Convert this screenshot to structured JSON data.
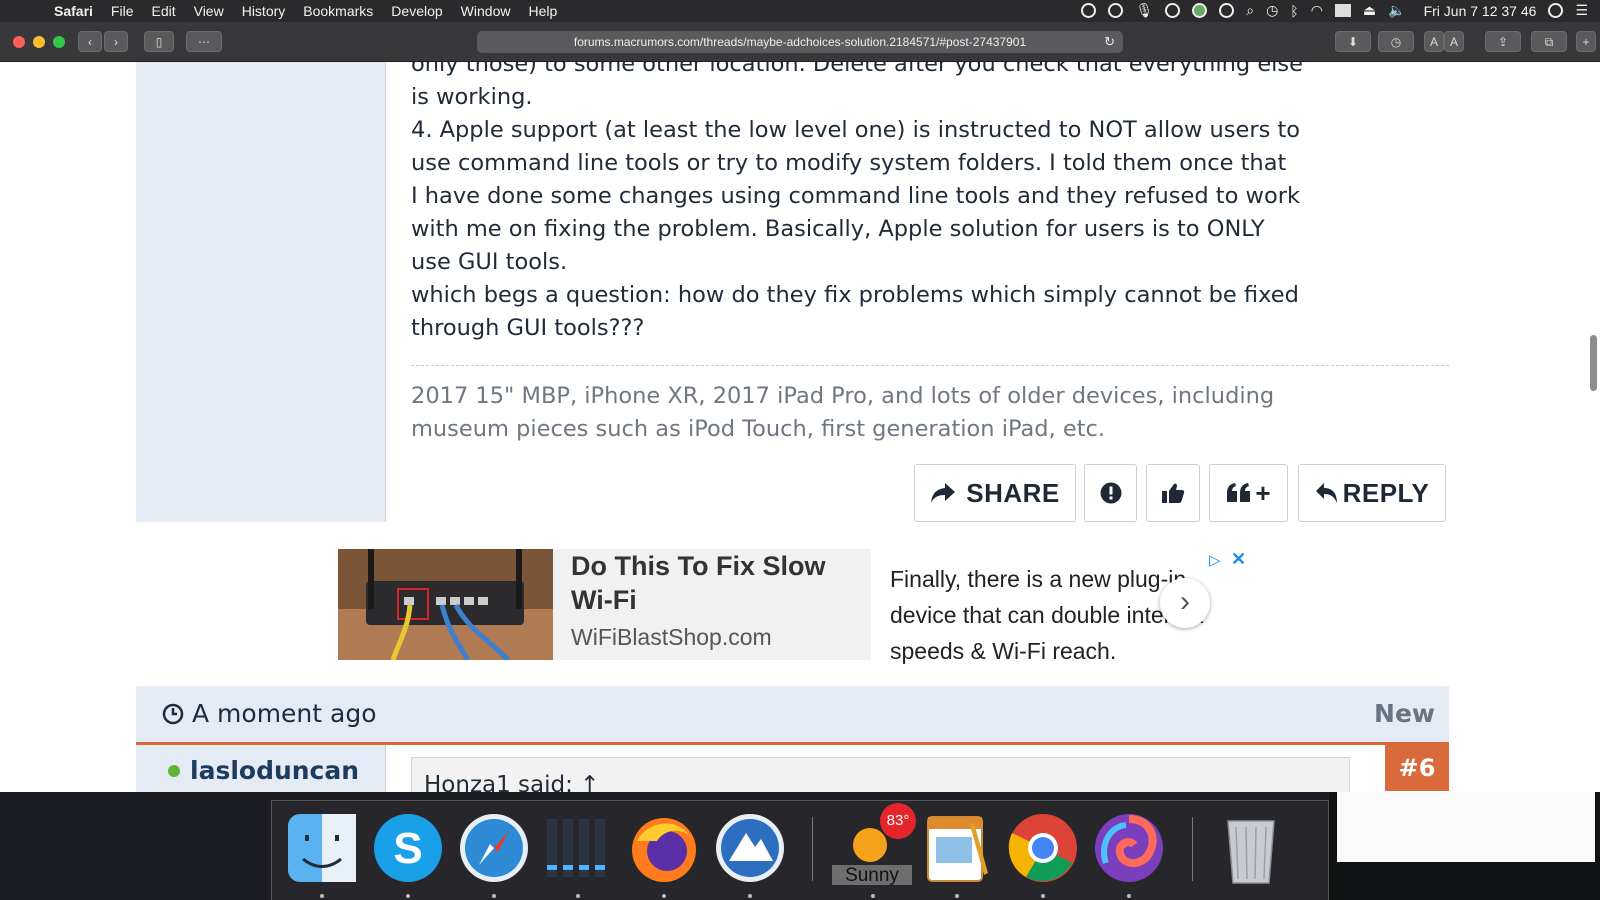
{
  "menubar": {
    "apple": "",
    "app": "Safari",
    "items": [
      "File",
      "Edit",
      "View",
      "History",
      "Bookmarks",
      "Develop",
      "Window",
      "Help"
    ],
    "clock": "Fri Jun 7  12 37 46"
  },
  "toolbar": {
    "url": "forums.macrumors.com/threads/maybe-adchoices-solution.2184571/#post-27437901",
    "text_size_small": "A",
    "text_size_large": "A"
  },
  "post": {
    "lines": [
      "only those) to some other location. Delete after you check that everything else",
      "is working.",
      "4. Apple support (at least the low level one) is instructed to NOT allow users to",
      "use command line tools or try to modify system folders. I told them once that",
      "I have done some changes using command line tools and they refused to work",
      "with me on fixing the problem. Basically, Apple solution for users is to ONLY",
      "use GUI tools.",
      "which begs a question: how do they fix problems which simply cannot be fixed",
      "through GUI tools???"
    ],
    "signature_lines": [
      "2017 15\" MBP, iPhone XR, 2017 iPad Pro, and lots of older devices, including",
      "museum pieces such as iPod Touch, first generation iPad, etc."
    ],
    "actions": {
      "share": "SHARE",
      "reply": "REPLY",
      "multiquote": "+"
    }
  },
  "ad": {
    "title": "Do This To Fix Slow Wi-Fi",
    "domain": "WiFiBlastShop.com",
    "body": "Finally, there is a new plug-in device that can double internet speeds & Wi-Fi reach."
  },
  "next_post": {
    "time": "A moment ago",
    "badge": "New",
    "username": "lasloduncan",
    "quote_attribution": "Honza1 said: ↑",
    "number": "#6"
  },
  "dock": {
    "weather_temp": "83°",
    "weather_label": "Sunny",
    "apps": [
      "finder",
      "skype",
      "safari",
      "audio-meter",
      "firefox",
      "mountain-app",
      "weather",
      "pages",
      "chrome",
      "spiral-app",
      "trash"
    ]
  }
}
